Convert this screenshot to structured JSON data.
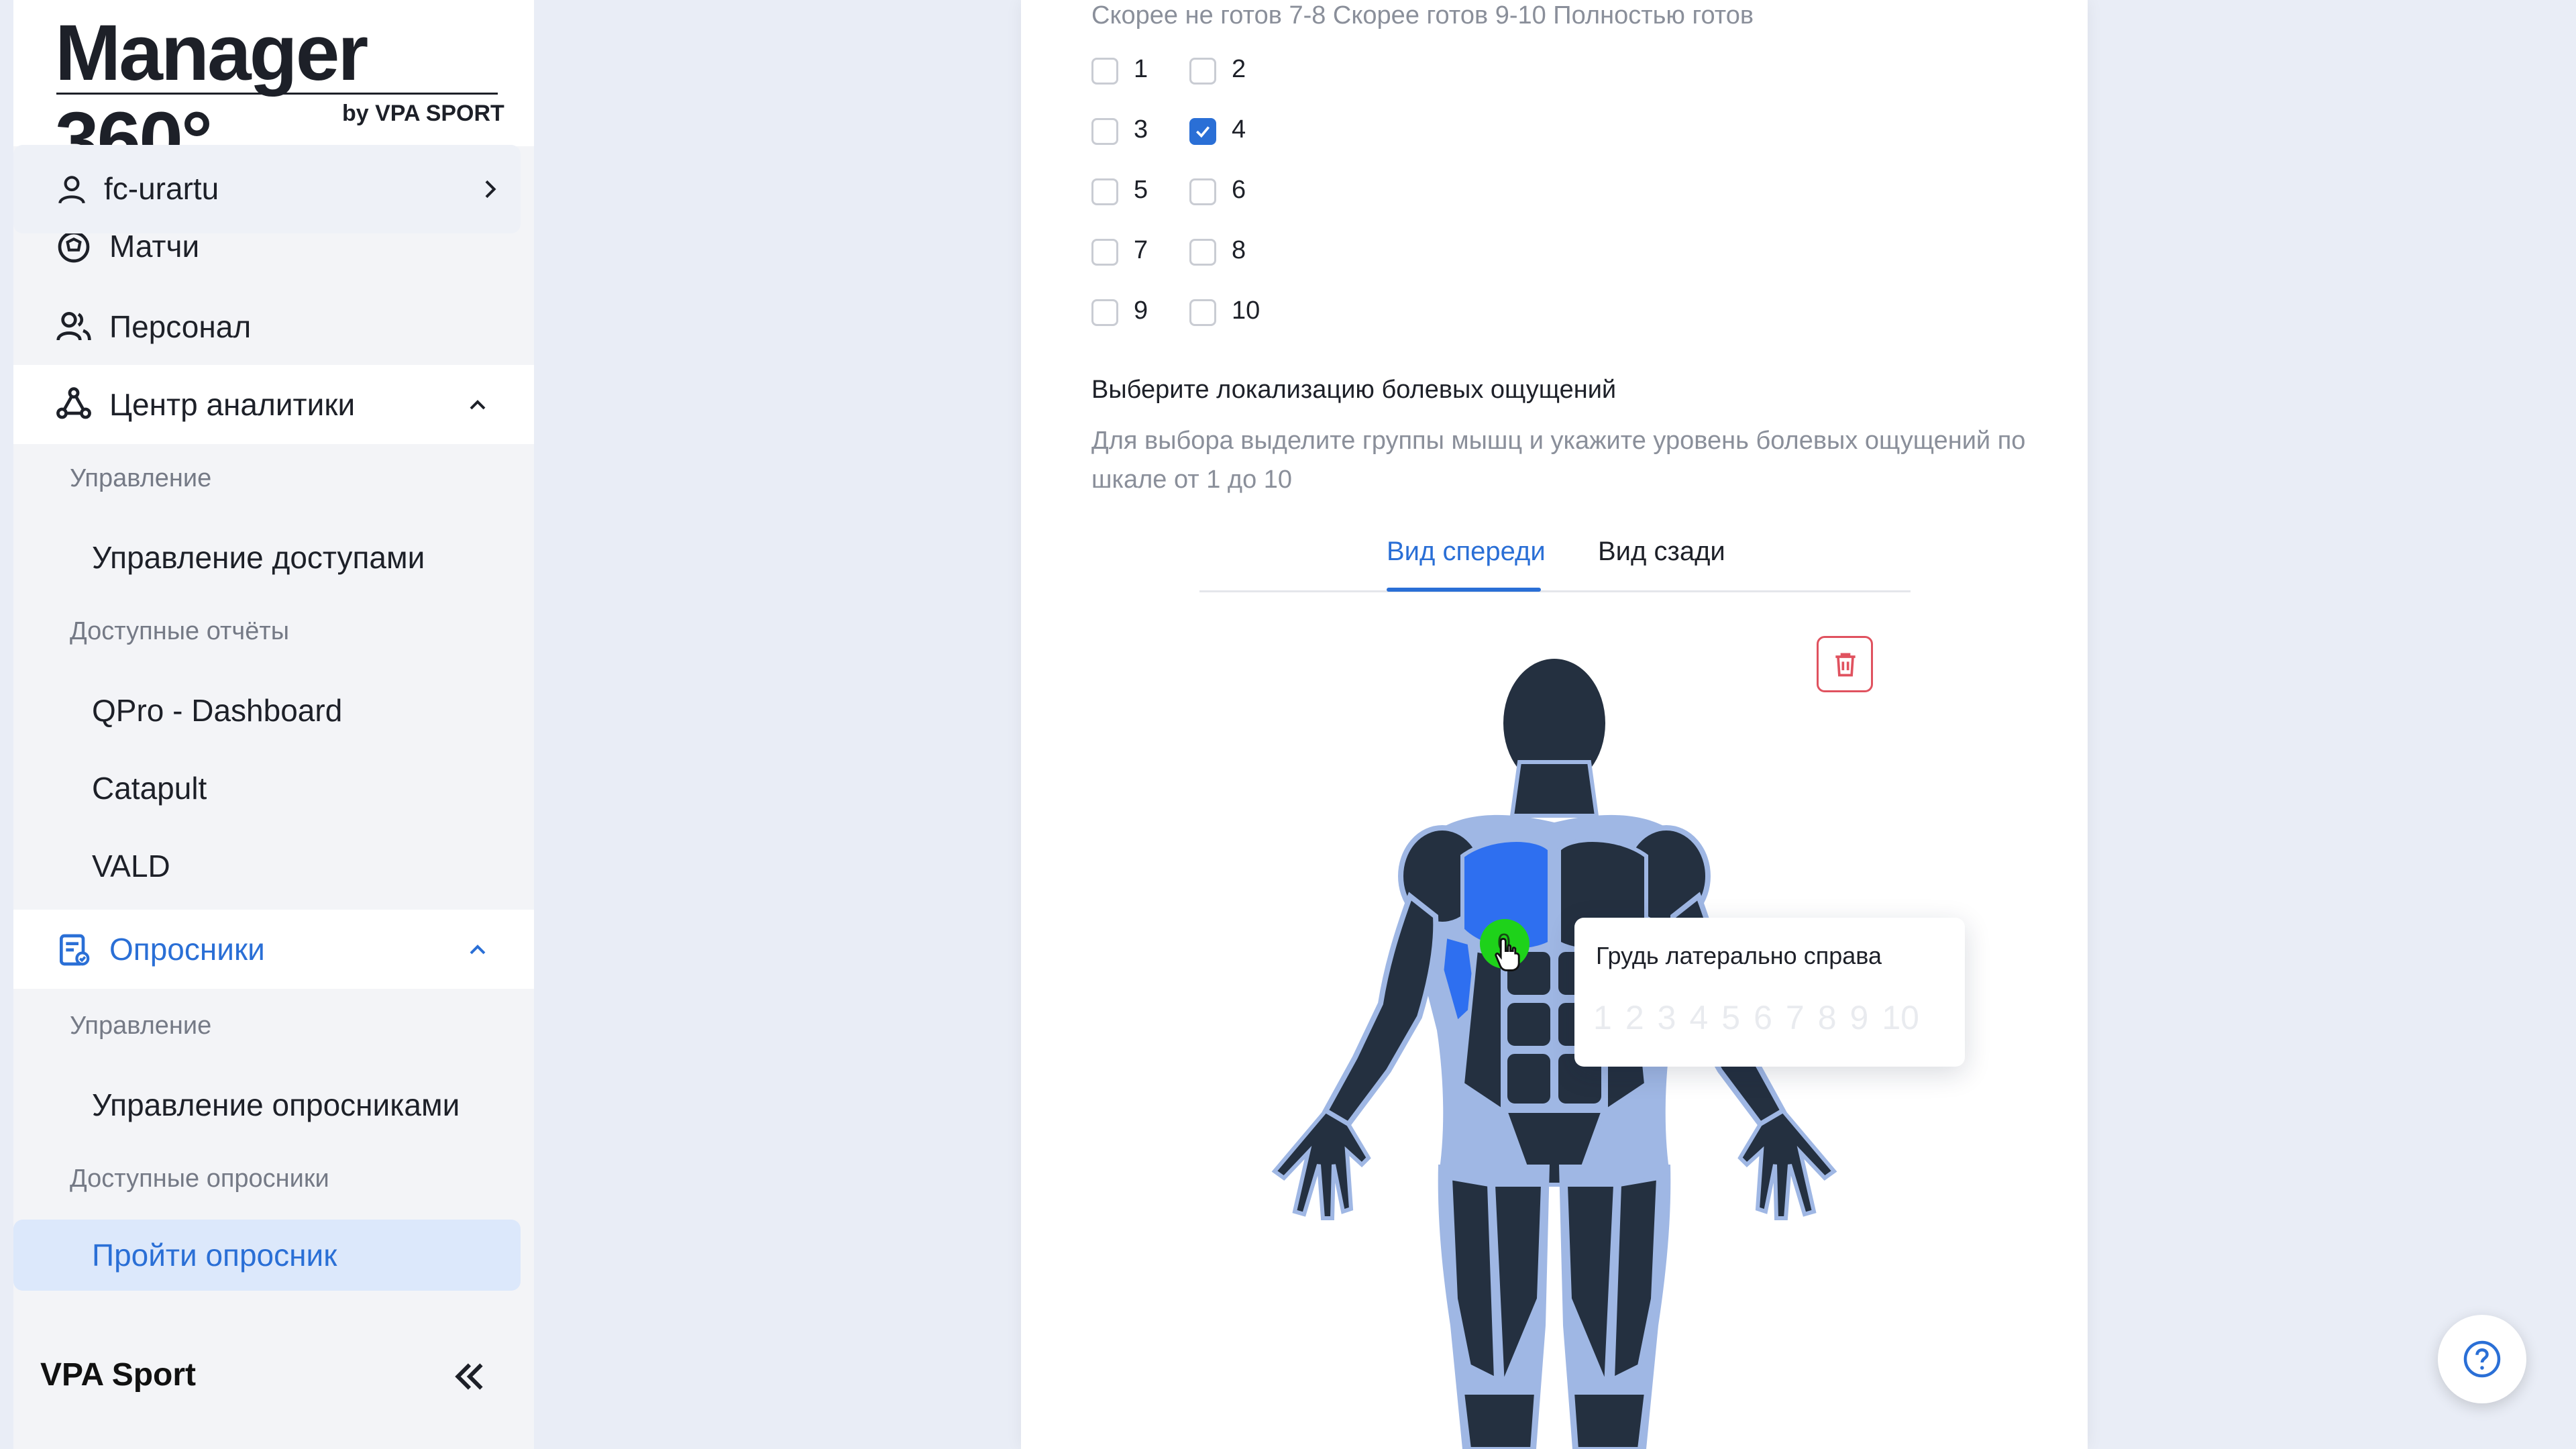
{
  "sidebar": {
    "brand_title": "Manager 360°",
    "brand_sub": "by VPA SPORT",
    "account": "fc-urartu",
    "nav": {
      "matches": "Матчи",
      "staff": "Персонал",
      "analytics": "Центр аналитики",
      "surveys": "Опросники"
    },
    "analytics_section": {
      "management_label": "Управление",
      "access_management": "Управление доступами",
      "reports_label": "Доступные отчёты",
      "reports": [
        "QPro - Dashboard",
        "Catapult",
        "VALD"
      ]
    },
    "surveys_section": {
      "management_label": "Управление",
      "survey_management": "Управление опросниками",
      "available_label": "Доступные опросники",
      "take_survey": "Пройти опросник"
    },
    "footer_brand": "VPA Sport",
    "colors": {
      "accent": "#2a6fd6",
      "active_bg": "#dce8fb"
    }
  },
  "form": {
    "scale_text": "Скорее не готов 7-8 Скорее готов 9-10 Полностью готов",
    "options": [
      "1",
      "2",
      "3",
      "4",
      "5",
      "6",
      "7",
      "8",
      "9",
      "10"
    ],
    "selected_option": "4",
    "pain_question": "Выберите локализацию болевых ощущений",
    "pain_hint": "Для выбора выделите группы мышц и укажите уровень болевых ощущений по шкале от 1 до 10",
    "tabs": {
      "front": "Вид спереди",
      "back": "Вид сзади",
      "active": "front"
    },
    "body_colors": {
      "muscle": "#243040",
      "outline": "#9fb7e4",
      "selected": "#2e6ff0"
    }
  },
  "tooltip": {
    "title": "Грудь латерально справа",
    "levels": [
      "1",
      "2",
      "3",
      "4",
      "5",
      "6",
      "7",
      "8",
      "9",
      "10"
    ]
  },
  "cursor_marker": {
    "value": "0",
    "color": "#1ed21a"
  },
  "icons": {
    "account": "user-icon",
    "matches": "ball-icon",
    "staff": "users-icon",
    "analytics": "network-icon",
    "surveys": "clipboard-icon",
    "delete": "trash-icon",
    "help": "question-icon",
    "collapse": "double-chevron-left-icon"
  }
}
